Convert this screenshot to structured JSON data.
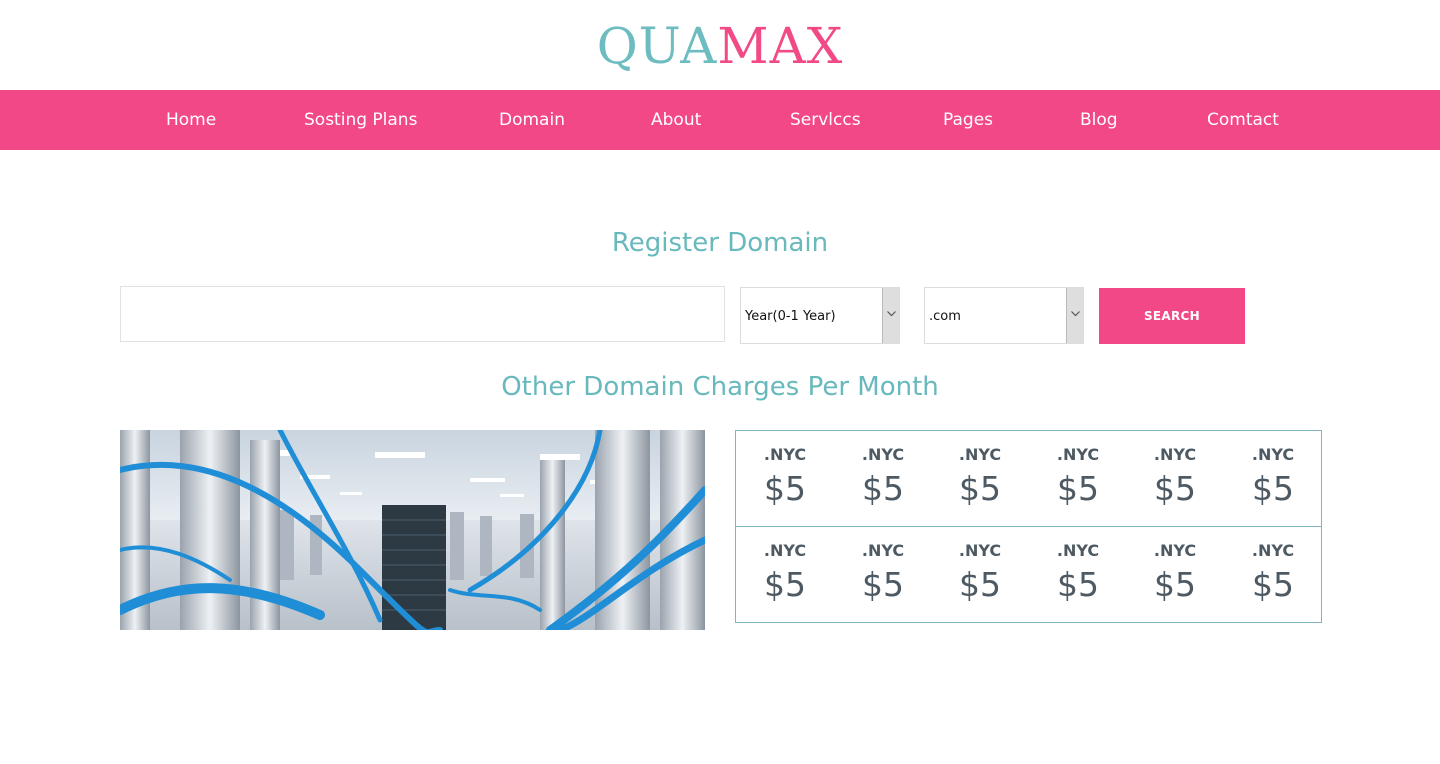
{
  "logo": {
    "part1": "QUA",
    "part2": "MAX"
  },
  "nav": [
    {
      "label": "Home"
    },
    {
      "label": "Sosting Plans"
    },
    {
      "label": "Domain"
    },
    {
      "label": "About"
    },
    {
      "label": "Servlccs"
    },
    {
      "label": "Pages"
    },
    {
      "label": "Blog"
    },
    {
      "label": "Comtact"
    }
  ],
  "register": {
    "title": "Register Domain",
    "input_value": "",
    "year_select": "Year(0-1 Year)",
    "tld_select": ".com",
    "search_label": "SEARCH"
  },
  "other": {
    "title": "Other Domain Charges Per Month",
    "rows": [
      [
        {
          "tld": ".NYC",
          "price": "$5"
        },
        {
          "tld": ".NYC",
          "price": "$5"
        },
        {
          "tld": ".NYC",
          "price": "$5"
        },
        {
          "tld": ".NYC",
          "price": "$5"
        },
        {
          "tld": ".NYC",
          "price": "$5"
        },
        {
          "tld": ".NYC",
          "price": "$5"
        }
      ],
      [
        {
          "tld": ".NYC",
          "price": "$5"
        },
        {
          "tld": ".NYC",
          "price": "$5"
        },
        {
          "tld": ".NYC",
          "price": "$5"
        },
        {
          "tld": ".NYC",
          "price": "$5"
        },
        {
          "tld": ".NYC",
          "price": "$5"
        },
        {
          "tld": ".NYC",
          "price": "$5"
        }
      ]
    ]
  },
  "colors": {
    "brand_pink": "#f34887",
    "brand_teal": "#68b9bd",
    "price_text": "#4d5a63"
  }
}
